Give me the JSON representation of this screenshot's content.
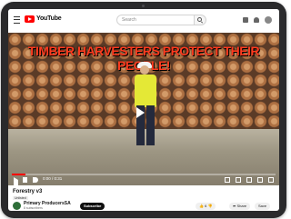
{
  "header": {
    "logo_text": "YouTube",
    "search_placeholder": "Search",
    "icons": [
      "menu-icon",
      "search-icon",
      "upload-icon",
      "bell-icon",
      "avatar"
    ]
  },
  "player": {
    "overlay_title": "TIMBER HARVESTERS PROTECT THEIR PEOPLE!",
    "time": "0:00 / 0:31",
    "progress": 0.05,
    "accent": "#ff0000"
  },
  "video": {
    "title": "Forestry v3",
    "badge": "Unlisted"
  },
  "channel": {
    "name": "Primary ProducersSA",
    "subscribers": "8 subscribers",
    "subscribe_label": "Subscribe"
  },
  "actions": {
    "likes": "6",
    "share_label": "Share",
    "save_label": "Save"
  }
}
